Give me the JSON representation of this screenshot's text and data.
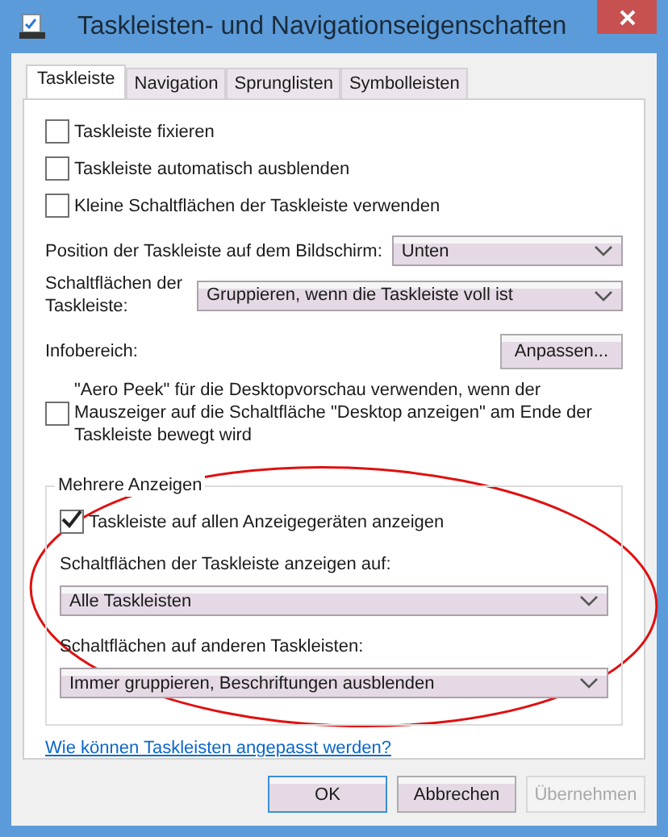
{
  "window": {
    "title": "Taskleisten- und Navigationseigenschaften"
  },
  "tabs": [
    {
      "label": "Taskleiste",
      "selected": true
    },
    {
      "label": "Navigation",
      "selected": false
    },
    {
      "label": "Sprunglisten",
      "selected": false
    },
    {
      "label": "Symbolleisten",
      "selected": false
    }
  ],
  "panel": {
    "items": [
      {
        "kind": "checkbox",
        "label": "Taskleiste fixieren",
        "checked": false
      },
      {
        "kind": "checkbox",
        "label": "Taskleiste automatisch ausblenden",
        "checked": false
      },
      {
        "kind": "checkbox",
        "label": "Kleine Schaltflächen der Taskleiste verwenden",
        "checked": false
      },
      {
        "kind": "gap"
      },
      {
        "kind": "select",
        "label": "Position der Taskleiste auf dem Bildschirm:",
        "value": "Unten"
      },
      {
        "kind": "select",
        "label": "Schaltflächen der Taskleiste:",
        "value": "Gruppieren, wenn die Taskleiste voll ist"
      },
      {
        "kind": "button",
        "label": "Infobereich:",
        "button": "Anpassen..."
      },
      {
        "kind": "checkbox",
        "label": "\"Aero Peek\" für die Desktopvorschau verwenden, wenn der Mauszeiger auf die Schaltfläche \"Desktop anzeigen\" am Ende der Taskleiste bewegt wird",
        "checked": false
      }
    ],
    "group": {
      "title": "Mehrere Anzeigen",
      "items": [
        {
          "kind": "checkbox",
          "label": "Taskleiste auf allen Anzeigegeräten anzeigen",
          "checked": true
        },
        {
          "kind": "stacked_select",
          "label": "Schaltflächen der Taskleiste anzeigen auf:",
          "value": "Alle Taskleisten"
        },
        {
          "kind": "stacked_select",
          "label": "Schaltflächen auf anderen Taskleisten:",
          "value": "Immer gruppieren, Beschriftungen ausblenden"
        }
      ]
    },
    "link": "Wie können Taskleisten angepasst werden?"
  },
  "buttons": [
    {
      "label": "OK",
      "default": true,
      "disabled": false
    },
    {
      "label": "Abbrechen",
      "default": false,
      "disabled": false
    },
    {
      "label": "Übernehmen",
      "default": false,
      "disabled": true
    }
  ]
}
